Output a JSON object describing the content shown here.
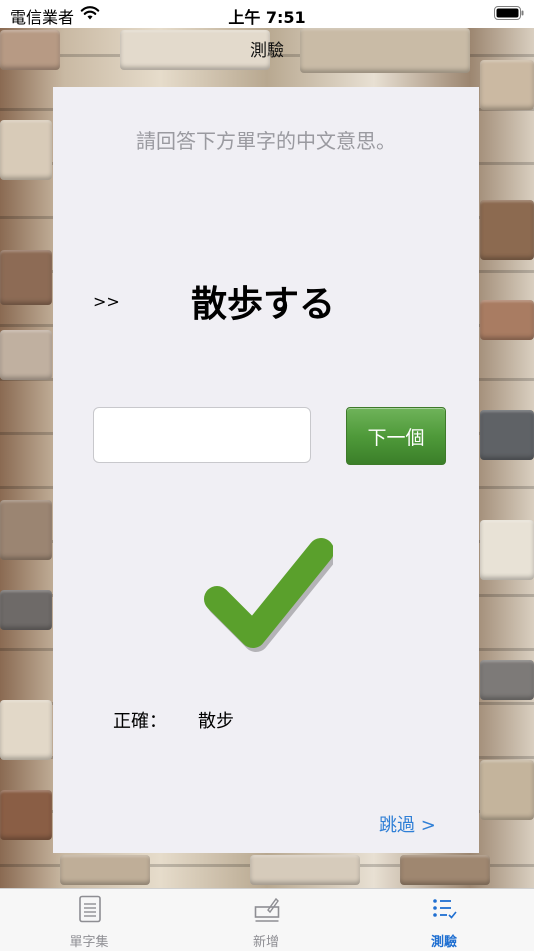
{
  "status": {
    "carrier": "電信業者",
    "time": "上午 7:51"
  },
  "nav": {
    "title": "測驗"
  },
  "quiz": {
    "prompt": "請回答下方單字的中文意思。",
    "arrow": ">>",
    "word": "散歩する",
    "answer_value": "",
    "answer_placeholder": "",
    "next_label": "下一個",
    "result_icon": "checkmark-icon",
    "correct_label": "正確：",
    "correct_answer": "散步",
    "skip_label": "跳過 >"
  },
  "tabbar": {
    "items": [
      {
        "label": "單字集",
        "icon": "document-list-icon",
        "active": false
      },
      {
        "label": "新增",
        "icon": "add-edit-icon",
        "active": false
      },
      {
        "label": "測驗",
        "icon": "checklist-icon",
        "active": true
      }
    ]
  },
  "colors": {
    "accent": "#1f6fd1",
    "button_green": "#4f9a3a",
    "check_green": "#5aa02c",
    "link_blue": "#2f7fd6"
  }
}
